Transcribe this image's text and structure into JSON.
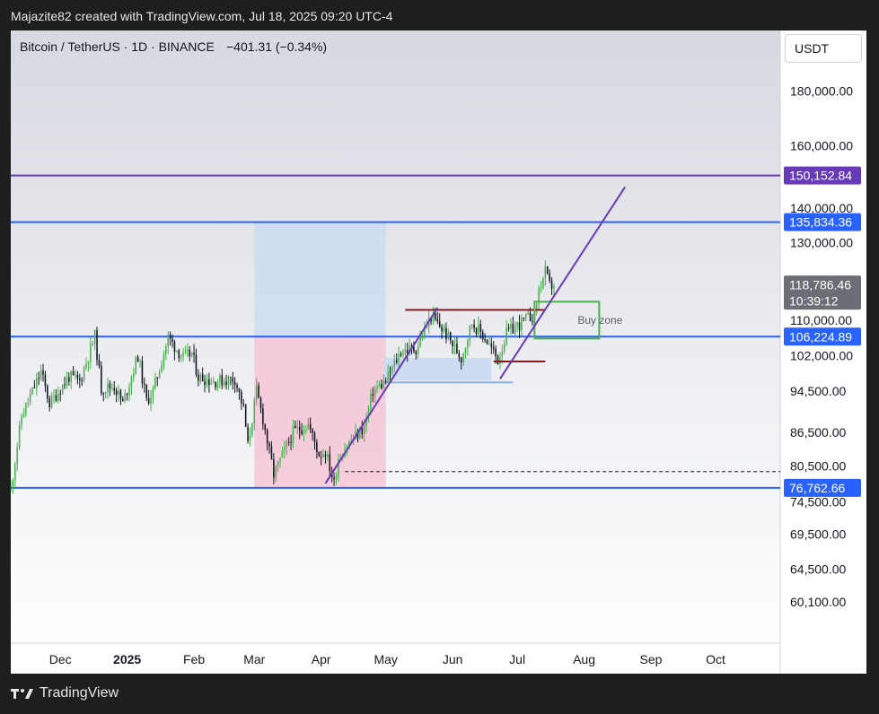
{
  "header": {
    "credit": "Majazite82 created with TradingView.com, Jul 18, 2025 09:20 UTC-4"
  },
  "footer": {
    "brand": "TradingView",
    "logo_icon": "tradingview-logo-icon"
  },
  "currency_button": "USDT",
  "colors": {
    "blue_line": "#2962ff",
    "purple_line": "#673ab7",
    "up_candle": "#4caf50",
    "down_candle": "#131722",
    "pink_zone": "#f5c6d6",
    "blue_zone": "#c9d9f2",
    "buy_zone": "#4caf50",
    "dark_red": "#8b1a1a",
    "current_badge": "#6b6d74"
  },
  "chart_data": {
    "type": "candlestick",
    "title": "Bitcoin / TetherUS · 1D · BINANCE",
    "change": "−401.31 (−0.34%)",
    "y_scale": "log",
    "ylim": [
      55000,
      205000
    ],
    "x_range": [
      "2024-11-08",
      "2025-10-31"
    ],
    "x_ticks": [
      {
        "date": "2024-12-01",
        "label": "Dec",
        "bold": false
      },
      {
        "date": "2025-01-01",
        "label": "2025",
        "bold": true
      },
      {
        "date": "2025-02-01",
        "label": "Feb",
        "bold": false
      },
      {
        "date": "2025-03-01",
        "label": "Mar",
        "bold": false
      },
      {
        "date": "2025-04-01",
        "label": "Apr",
        "bold": false
      },
      {
        "date": "2025-05-01",
        "label": "May",
        "bold": false
      },
      {
        "date": "2025-06-01",
        "label": "Jun",
        "bold": false
      },
      {
        "date": "2025-07-01",
        "label": "Jul",
        "bold": false
      },
      {
        "date": "2025-08-01",
        "label": "Aug",
        "bold": false
      },
      {
        "date": "2025-09-01",
        "label": "Sep",
        "bold": false
      },
      {
        "date": "2025-10-01",
        "label": "Oct",
        "bold": false
      }
    ],
    "y_ticks": [
      {
        "value": 180000,
        "label": "180,000.00"
      },
      {
        "value": 160000,
        "label": "160,000.00"
      },
      {
        "value": 140000,
        "label": "140,000.00"
      },
      {
        "value": 130000,
        "label": "130,000.00"
      },
      {
        "value": 110000,
        "label": "110,000.00"
      },
      {
        "value": 102000,
        "label": "102,000.00"
      },
      {
        "value": 94500,
        "label": "94,500.00"
      },
      {
        "value": 86500,
        "label": "86,500.00"
      },
      {
        "value": 80500,
        "label": "80,500.00"
      },
      {
        "value": 74500,
        "label": "74,500.00"
      },
      {
        "value": 69500,
        "label": "69,500.00"
      },
      {
        "value": 64500,
        "label": "64,500.00"
      },
      {
        "value": 60100,
        "label": "60,100.00"
      }
    ],
    "level_lines": [
      {
        "value": 150152.84,
        "label": "150,152.84",
        "color": "#673ab7"
      },
      {
        "value": 135834.36,
        "label": "135,834.36",
        "color": "#2962ff"
      },
      {
        "value": 106224.89,
        "label": "106,224.89",
        "color": "#2962ff"
      },
      {
        "value": 76762.66,
        "label": "76,762.66",
        "color": "#2962ff"
      }
    ],
    "current_price": {
      "value": 118786.46,
      "label": "118,786.46",
      "countdown": "10:39:12"
    },
    "dashed_line": {
      "value": 79500,
      "from": "2025-04-12"
    },
    "zones": [
      {
        "kind": "blue",
        "from": "2025-03-01",
        "to": "2025-05-01",
        "top": 135834.36,
        "bottom": 106224.89
      },
      {
        "kind": "pink",
        "from": "2025-03-01",
        "to": "2025-05-01",
        "top": 106224.89,
        "bottom": 76762.66
      },
      {
        "kind": "blue",
        "from": "2025-04-30",
        "to": "2025-06-19",
        "top": 101500,
        "bottom": 96700
      }
    ],
    "lower_bracket_line": {
      "from": "2025-04-30",
      "to": "2025-06-29",
      "value": 96300
    },
    "buy_zone": {
      "label": "Buy zone",
      "from": "2025-07-09",
      "to": "2025-08-08",
      "top": 114500,
      "bottom": 105800
    },
    "red_lines": [
      {
        "from": "2025-05-10",
        "to": "2025-07-14",
        "value": 112500
      },
      {
        "from": "2025-06-20",
        "to": "2025-07-14",
        "value": 100700
      }
    ],
    "trend_lines": [
      {
        "from": [
          "2025-04-03",
          77500
        ],
        "to": [
          "2025-05-25",
          113000
        ]
      },
      {
        "from": [
          "2025-06-23",
          97000
        ],
        "to": [
          "2025-08-20",
          146500
        ]
      }
    ],
    "candles_keypoints": [
      [
        "2024-11-08",
        76500
      ],
      [
        "2024-11-13",
        89500
      ],
      [
        "2024-11-22",
        98500
      ],
      [
        "2024-11-26",
        92000
      ],
      [
        "2024-12-05",
        97500
      ],
      [
        "2024-12-10",
        96500
      ],
      [
        "2024-12-17",
        106300
      ],
      [
        "2024-12-20",
        95000
      ],
      [
        "2024-12-26",
        95500
      ],
      [
        "2024-12-30",
        92000
      ],
      [
        "2025-01-06",
        102000
      ],
      [
        "2025-01-10",
        92500
      ],
      [
        "2025-01-13",
        94500
      ],
      [
        "2025-01-20",
        106000
      ],
      [
        "2025-01-27",
        101500
      ],
      [
        "2025-01-31",
        102500
      ],
      [
        "2025-02-03",
        97500
      ],
      [
        "2025-02-10",
        96500
      ],
      [
        "2025-02-20",
        97000
      ],
      [
        "2025-02-24",
        91000
      ],
      [
        "2025-02-26",
        84000
      ],
      [
        "2025-03-02",
        94500
      ],
      [
        "2025-03-05",
        89000
      ],
      [
        "2025-03-10",
        79000
      ],
      [
        "2025-03-19",
        86500
      ],
      [
        "2025-03-26",
        88000
      ],
      [
        "2025-03-31",
        82500
      ],
      [
        "2025-04-03",
        83000
      ],
      [
        "2025-04-07",
        77500
      ],
      [
        "2025-04-09",
        82000
      ],
      [
        "2025-04-14",
        84500
      ],
      [
        "2025-04-21",
        87500
      ],
      [
        "2025-04-25",
        94500
      ],
      [
        "2025-05-01",
        96500
      ],
      [
        "2025-05-08",
        103000
      ],
      [
        "2025-05-15",
        103500
      ],
      [
        "2025-05-22",
        111000
      ],
      [
        "2025-05-28",
        107500
      ],
      [
        "2025-06-01",
        104500
      ],
      [
        "2025-06-05",
        101500
      ],
      [
        "2025-06-10",
        109500
      ],
      [
        "2025-06-16",
        106000
      ],
      [
        "2025-06-22",
        101000
      ],
      [
        "2025-06-26",
        107000
      ],
      [
        "2025-07-03",
        109500
      ],
      [
        "2025-07-09",
        111500
      ],
      [
        "2025-07-11",
        117500
      ],
      [
        "2025-07-14",
        122000
      ],
      [
        "2025-07-16",
        118500
      ],
      [
        "2025-07-18",
        118786
      ]
    ]
  }
}
